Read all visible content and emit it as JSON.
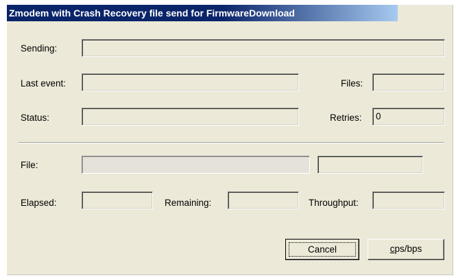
{
  "window": {
    "title": "Zmodem with Crash Recovery file send for FirmwareDownload"
  },
  "labels": {
    "sending": "Sending:",
    "last_event": "Last event:",
    "files": "Files:",
    "status": "Status:",
    "retries": "Retries:",
    "file": "File:",
    "elapsed": "Elapsed:",
    "remaining": "Remaining:",
    "throughput": "Throughput:"
  },
  "fields": {
    "sending": "",
    "last_event": "",
    "files": "",
    "status": "",
    "retries": "0",
    "file_name": "",
    "file_size": "",
    "elapsed": "",
    "remaining": "",
    "throughput": ""
  },
  "buttons": {
    "cancel": "Cancel",
    "cps_bps_first": "c",
    "cps_bps_rest": "ps/bps"
  }
}
